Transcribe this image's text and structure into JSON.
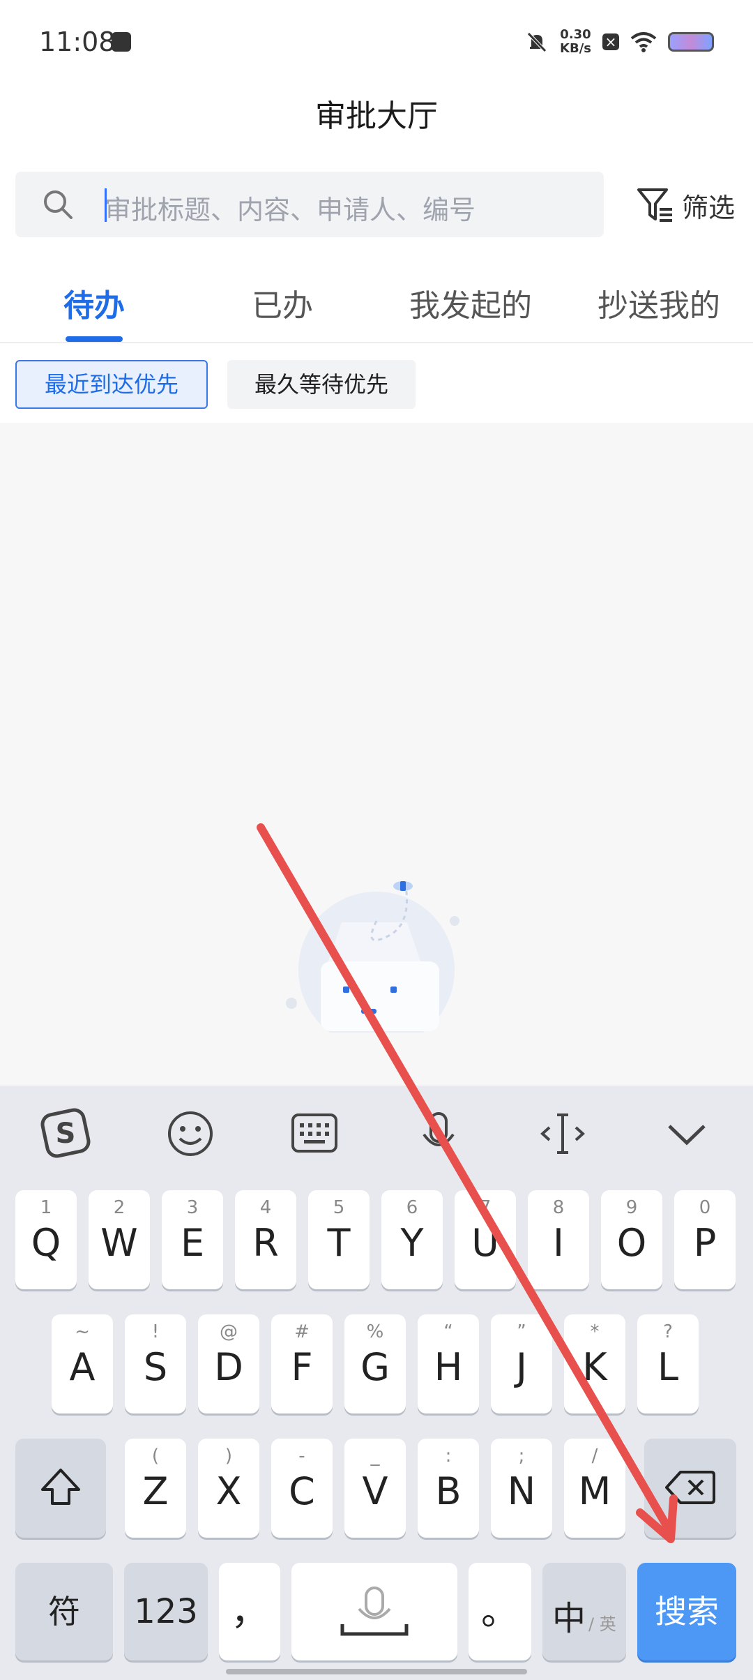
{
  "status_bar": {
    "time": "11:08",
    "net_speed_value": "0.30",
    "net_speed_unit": "KB/s"
  },
  "header": {
    "title": "审批大厅",
    "search_placeholder": "审批标题、内容、申请人、编号",
    "filter_label": "筛选"
  },
  "tabs": [
    {
      "label": "待办",
      "active": true
    },
    {
      "label": "已办",
      "active": false
    },
    {
      "label": "我发起的",
      "active": false
    },
    {
      "label": "抄送我的",
      "active": false
    }
  ],
  "sort_chips": [
    {
      "label": "最近到达优先",
      "active": true
    },
    {
      "label": "最久等待优先",
      "active": false
    }
  ],
  "keyboard": {
    "toolbar_icons": [
      "sogou-logo-icon",
      "emoji-icon",
      "keyboard-icon",
      "microphone-icon",
      "cursor-icon",
      "collapse-icon"
    ],
    "row1": [
      {
        "main": "Q",
        "sub": "1"
      },
      {
        "main": "W",
        "sub": "2"
      },
      {
        "main": "E",
        "sub": "3"
      },
      {
        "main": "R",
        "sub": "4"
      },
      {
        "main": "T",
        "sub": "5"
      },
      {
        "main": "Y",
        "sub": "6"
      },
      {
        "main": "U",
        "sub": "7"
      },
      {
        "main": "I",
        "sub": "8"
      },
      {
        "main": "O",
        "sub": "9"
      },
      {
        "main": "P",
        "sub": "0"
      }
    ],
    "row2": [
      {
        "main": "A",
        "sub": "~"
      },
      {
        "main": "S",
        "sub": "!"
      },
      {
        "main": "D",
        "sub": "@"
      },
      {
        "main": "F",
        "sub": "#"
      },
      {
        "main": "G",
        "sub": "%"
      },
      {
        "main": "H",
        "sub": "“"
      },
      {
        "main": "J",
        "sub": "”"
      },
      {
        "main": "K",
        "sub": "*"
      },
      {
        "main": "L",
        "sub": "?"
      }
    ],
    "row3": [
      {
        "main": "Z",
        "sub": "("
      },
      {
        "main": "X",
        "sub": ")"
      },
      {
        "main": "C",
        "sub": "-"
      },
      {
        "main": "V",
        "sub": "_"
      },
      {
        "main": "B",
        "sub": ":"
      },
      {
        "main": "N",
        "sub": ";"
      },
      {
        "main": "M",
        "sub": "/"
      }
    ],
    "symbol_key": "符",
    "number_key": "123",
    "comma_key": "，",
    "period_key": "。",
    "lang_key_main": "中",
    "lang_key_sub": "/ 英",
    "search_key": "搜索"
  },
  "colors": {
    "accent": "#1f6ce8",
    "search_key": "#4d97f5",
    "annotation_arrow": "#e8504d"
  }
}
